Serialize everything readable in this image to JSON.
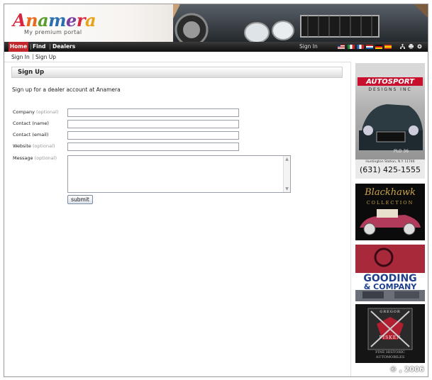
{
  "brand": {
    "logo_letters": [
      "A",
      "n",
      "a",
      "m",
      "e",
      "r",
      "a"
    ],
    "tagline": "My premium portal"
  },
  "nav": {
    "home": "Home",
    "find": "Find",
    "dealers": "Dealers",
    "signin": "Sign In",
    "flags": [
      "us-flag",
      "it-flag",
      "fr-flag",
      "nl-flag",
      "de-flag",
      "es-flag"
    ],
    "tool_icons": [
      "sitemap-icon",
      "print-icon",
      "settings-icon"
    ]
  },
  "subnav": {
    "signin": "Sign In",
    "signup": "Sign Up"
  },
  "page": {
    "title": "Sign Up",
    "intro": "Sign up for a dealer account at Anamera"
  },
  "form": {
    "fields": [
      {
        "label": "Company",
        "optional": "(optional)"
      },
      {
        "label": "Contact (name)",
        "optional": ""
      },
      {
        "label": "Contact (email)",
        "optional": ""
      },
      {
        "label": "Website",
        "optional": "(optional)"
      },
      {
        "label": "Message",
        "optional": "(optional)"
      }
    ],
    "submit_label": "submit"
  },
  "ads": {
    "autosport": {
      "name": "AUTOSPORT",
      "sub": "DESIGNS INC",
      "location": "Huntington Station, N.Y. 11746",
      "phone": "(631) 425-1555",
      "plate": "PLO 36"
    },
    "blackhawk": {
      "line1": "Blackhawk",
      "line2": "COLLECTION"
    },
    "gooding": {
      "line1": "GOODING",
      "line2": "& COMPANY"
    },
    "fisken": {
      "line1": "GREGOR",
      "line2": "FISKEN",
      "line3": "FINE HISTORIC",
      "line4": "AUTOMOBILES"
    }
  },
  "watermark": "© , 2006",
  "colors": {
    "nav_active": "#c0282d",
    "nav_bg": "#1a1a1a",
    "link": "#222222"
  }
}
